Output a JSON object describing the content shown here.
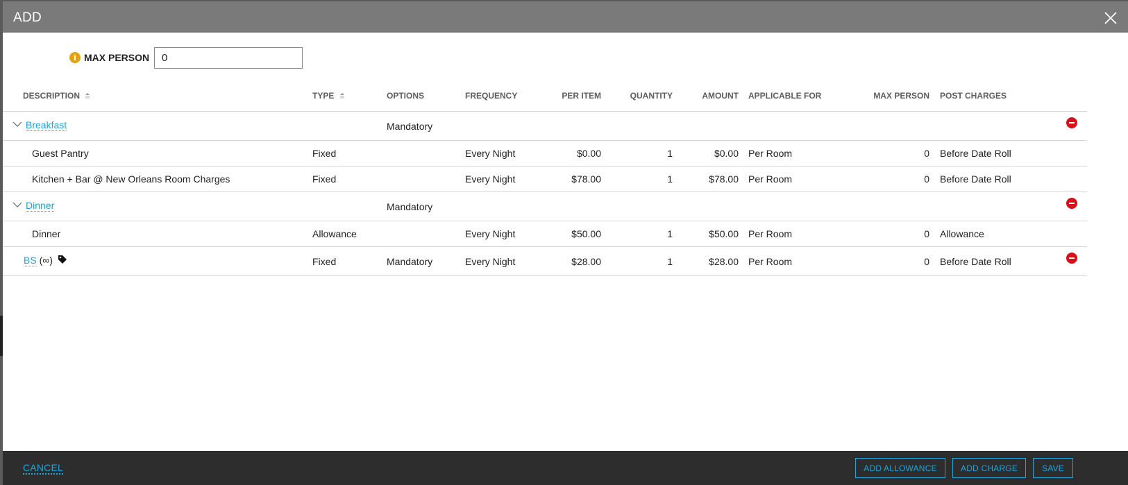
{
  "dialog": {
    "title": "ADD",
    "close_icon": "close-icon"
  },
  "max_person": {
    "label": "MAX PERSON",
    "value": "0",
    "icon": "info-icon",
    "icon_color": "#e4a10a"
  },
  "columns": {
    "description": "DESCRIPTION",
    "type": "TYPE",
    "options": "OPTIONS",
    "frequency": "FREQUENCY",
    "per_item": "PER ITEM",
    "quantity": "QUANTITY",
    "amount": "AMOUNT",
    "applicable_for": "APPLICABLE FOR",
    "max_person": "MAX PERSON",
    "post_charges": "POST CHARGES"
  },
  "rows": [
    {
      "kind": "group",
      "description": "Breakfast",
      "options": "Mandatory"
    },
    {
      "kind": "child",
      "description": "Guest Pantry",
      "type": "Fixed",
      "frequency": "Every Night",
      "per_item": "$0.00",
      "quantity": "1",
      "amount": "$0.00",
      "applicable_for": "Per Room",
      "max_person": "0",
      "post_charges": "Before Date Roll"
    },
    {
      "kind": "child",
      "description": "Kitchen + Bar @ New Orleans Room Charges",
      "type": "Fixed",
      "frequency": "Every Night",
      "per_item": "$78.00",
      "quantity": "1",
      "amount": "$78.00",
      "applicable_for": "Per Room",
      "max_person": "0",
      "post_charges": "Before Date Roll"
    },
    {
      "kind": "group",
      "description": "Dinner",
      "options": "Mandatory"
    },
    {
      "kind": "child",
      "description": "Dinner",
      "type": "Allowance",
      "frequency": "Every Night",
      "per_item": "$50.00",
      "quantity": "1",
      "amount": "$50.00",
      "applicable_for": "Per Room",
      "max_person": "0",
      "post_charges": "Allowance"
    },
    {
      "kind": "single",
      "description": "BS",
      "suffix": "(∞)",
      "type": "Fixed",
      "options": "Mandatory",
      "frequency": "Every Night",
      "per_item": "$28.00",
      "quantity": "1",
      "amount": "$28.00",
      "applicable_for": "Per Room",
      "max_person": "0",
      "post_charges": "Before Date Roll"
    }
  ],
  "footer": {
    "cancel": "CANCEL",
    "add_allowance": "ADD ALLOWANCE",
    "add_charge": "ADD CHARGE",
    "save": "SAVE"
  },
  "colors": {
    "accent": "#1aa6de",
    "remove": "#d9101a",
    "titlebar": "#7a7a7a",
    "footer": "#2d2d2d"
  }
}
